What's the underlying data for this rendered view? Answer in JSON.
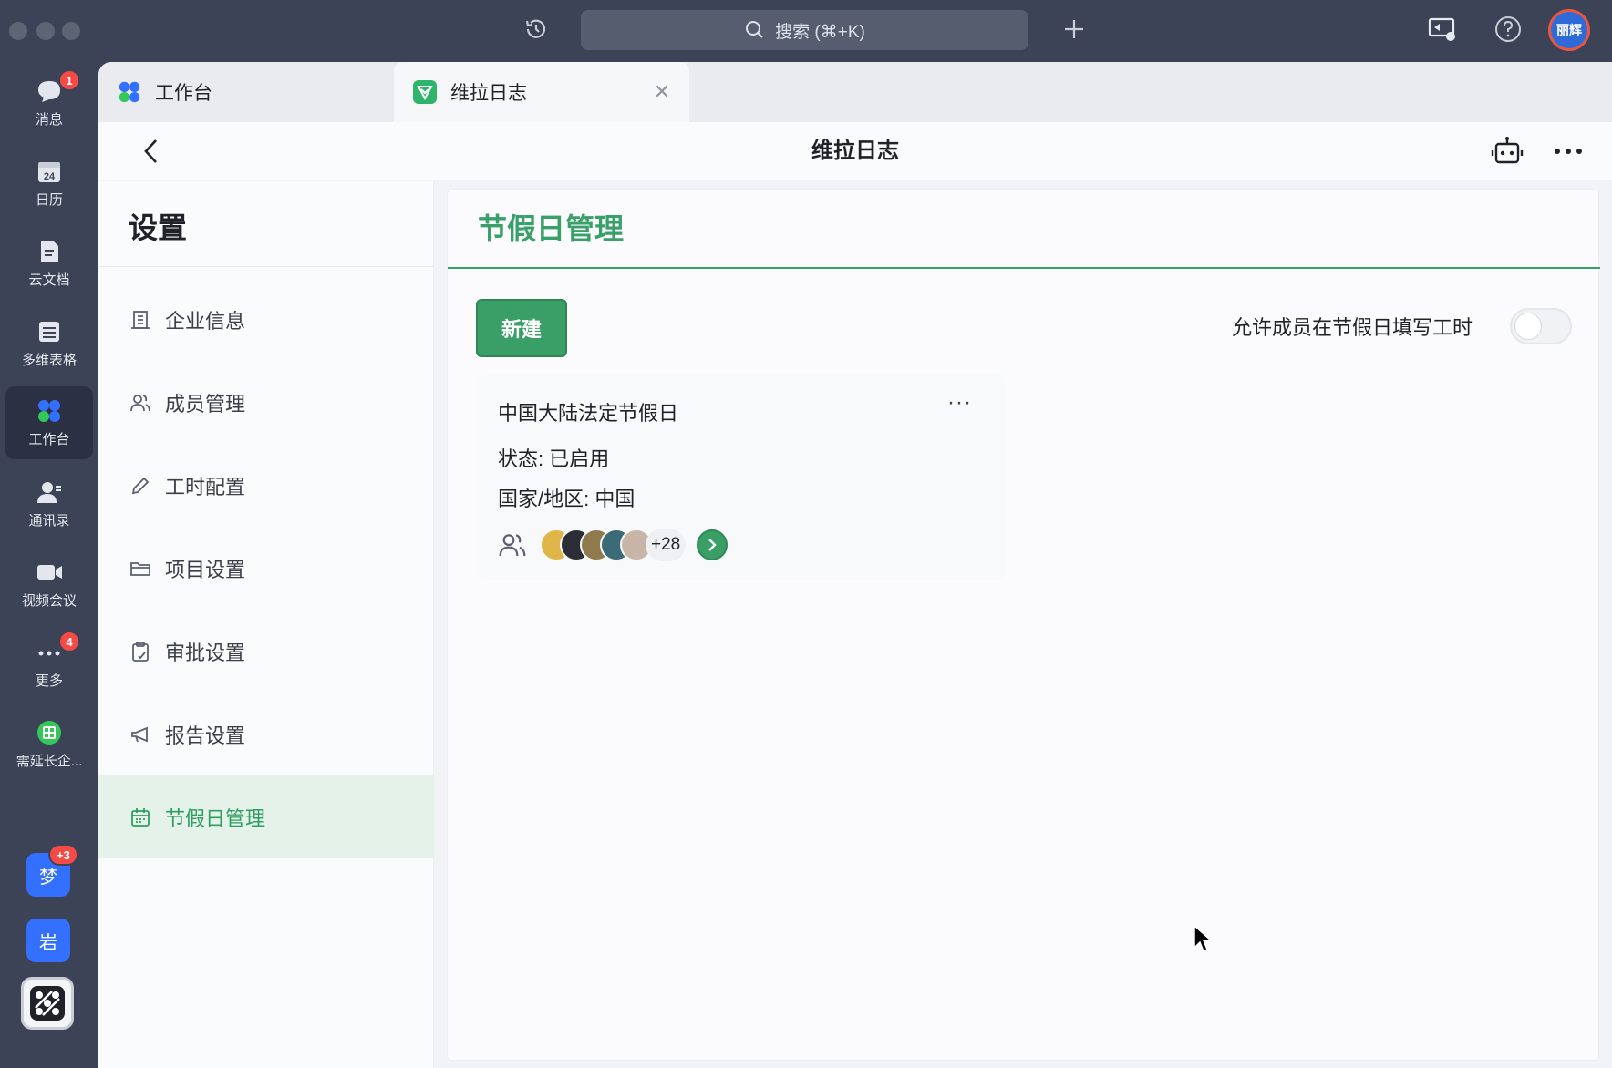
{
  "titlebar": {
    "search_text": "搜索 (⌘+K)",
    "user_avatar_text": "丽辉"
  },
  "leftnav": {
    "items": [
      {
        "label": "消息",
        "icon": "chat-bubble-icon",
        "badge": "1"
      },
      {
        "label": "日历",
        "icon": "calendar-icon",
        "day": "24"
      },
      {
        "label": "云文档",
        "icon": "document-icon"
      },
      {
        "label": "多维表格",
        "icon": "table-icon"
      },
      {
        "label": "工作台",
        "icon": "workplace-grid-icon",
        "active": true
      },
      {
        "label": "通讯录",
        "icon": "contacts-icon"
      },
      {
        "label": "视频会议",
        "icon": "video-camera-icon"
      },
      {
        "label": "更多",
        "icon": "more-dots-icon",
        "badge": "4"
      },
      {
        "label": "需延长企...",
        "icon": "green-app-icon"
      }
    ],
    "chats": [
      {
        "text": "梦",
        "badge": "+3"
      },
      {
        "text": "岩"
      }
    ]
  },
  "tabs": [
    {
      "label": "工作台",
      "icon": "workplace-grid-icon"
    },
    {
      "label": "维拉日志",
      "icon": "vera-log-icon",
      "active": true
    }
  ],
  "header": {
    "title": "维拉日志"
  },
  "settings": {
    "title": "设置",
    "menu": [
      {
        "label": "企业信息",
        "icon": "building-icon"
      },
      {
        "label": "成员管理",
        "icon": "members-icon"
      },
      {
        "label": "工时配置",
        "icon": "pencil-icon"
      },
      {
        "label": "项目设置",
        "icon": "folder-icon"
      },
      {
        "label": "审批设置",
        "icon": "clipboard-icon"
      },
      {
        "label": "报告设置",
        "icon": "megaphone-icon"
      },
      {
        "label": "节假日管理",
        "icon": "calendar-icon",
        "active": true
      }
    ]
  },
  "main": {
    "title": "节假日管理",
    "new_button": "新建",
    "allow_label": "允许成员在节假日填写工时",
    "allow_toggle_on": false,
    "card": {
      "name": "中国大陆法定节假日",
      "more": "···",
      "status": "状态: 已启用",
      "region": "国家/地区: 中国",
      "member_count": "+28"
    }
  },
  "colors": {
    "accent": "#3aa06a",
    "nav_bg": "#3c4356",
    "badge": "#f54a45",
    "chat_avatar": "#3370ff"
  }
}
